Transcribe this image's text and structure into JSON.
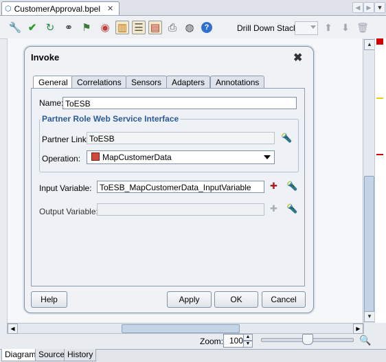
{
  "editor": {
    "document_tab": "CustomerApproval.bpel"
  },
  "toolbar": {
    "drill_down_label": "Drill Down Stack:",
    "icons": [
      "wrench-icon",
      "check-icon",
      "refresh-icon",
      "binoculars-icon",
      "flag-icon",
      "palette-icon",
      "book-icon",
      "list-icon",
      "print-icon",
      "camera-icon",
      "help-icon"
    ]
  },
  "dialog": {
    "title": "Invoke",
    "tabs": [
      "General",
      "Correlations",
      "Sensors",
      "Adapters",
      "Annotations"
    ],
    "active_tab": "General",
    "name_label": "Name:",
    "name_value": "ToESB",
    "group_title": "Partner Role Web Service Interface",
    "partner_link_label": "Partner Link:",
    "partner_link_value": "ToESB",
    "operation_label": "Operation:",
    "operation_value": "MapCustomerData",
    "input_variable_label": "Input Variable:",
    "input_variable_value": "ToESB_MapCustomerData_InputVariable",
    "output_variable_label": "Output Variable:",
    "output_variable_value": "",
    "buttons": {
      "help": "Help",
      "apply": "Apply",
      "ok": "OK",
      "cancel": "Cancel"
    }
  },
  "zoom": {
    "label": "Zoom:",
    "value": "100"
  },
  "bottom_tabs": [
    "Diagram",
    "Source",
    "History"
  ],
  "colors": {
    "accent": "#2b5a9a",
    "error_mark": "#d00000",
    "warning_mark": "#e6d000"
  }
}
